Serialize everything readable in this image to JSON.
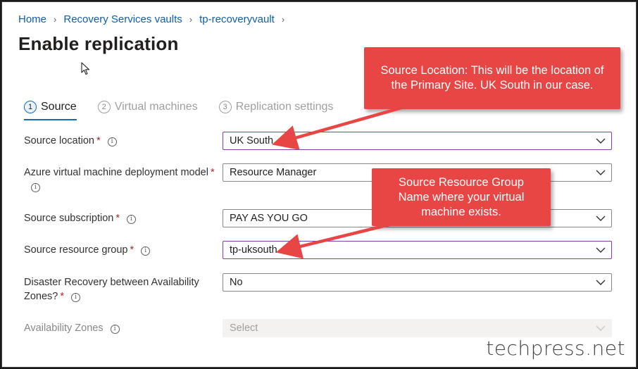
{
  "breadcrumb": {
    "home": "Home",
    "vaults": "Recovery Services vaults",
    "vault": "tp-recoveryvault"
  },
  "page": {
    "title": "Enable replication"
  },
  "steps": [
    {
      "num": "1",
      "label": "Source"
    },
    {
      "num": "2",
      "label": "Virtual machines"
    },
    {
      "num": "3",
      "label": "Replication settings"
    }
  ],
  "form": {
    "source_location": {
      "label": "Source location",
      "value": "UK South"
    },
    "deployment_model": {
      "label": "Azure virtual machine deployment model",
      "value": "Resource Manager"
    },
    "subscription": {
      "label": "Source subscription",
      "value": "PAY AS YOU GO"
    },
    "resource_group": {
      "label": "Source resource group",
      "value": "tp-uksouth"
    },
    "dr_zones": {
      "label_line1": "Disaster Recovery between Availability",
      "label_line2": "Zones?",
      "value": "No"
    },
    "availability_zones": {
      "label": "Availability Zones",
      "placeholder": "Select"
    }
  },
  "required_marker": "*",
  "info_glyph": "i",
  "callouts": {
    "location": "Source Location: This will be the location of the Primary Site. UK South in our case.",
    "resource_group": "Source Resource Group Name where your virtual machine exists."
  },
  "watermark": "techpress.net",
  "colors": {
    "link": "#0f5ea8",
    "accent": "#0f6cbd",
    "callout": "#e84545",
    "required": "#a4262c",
    "highlight_border": "#7b3fb0"
  }
}
